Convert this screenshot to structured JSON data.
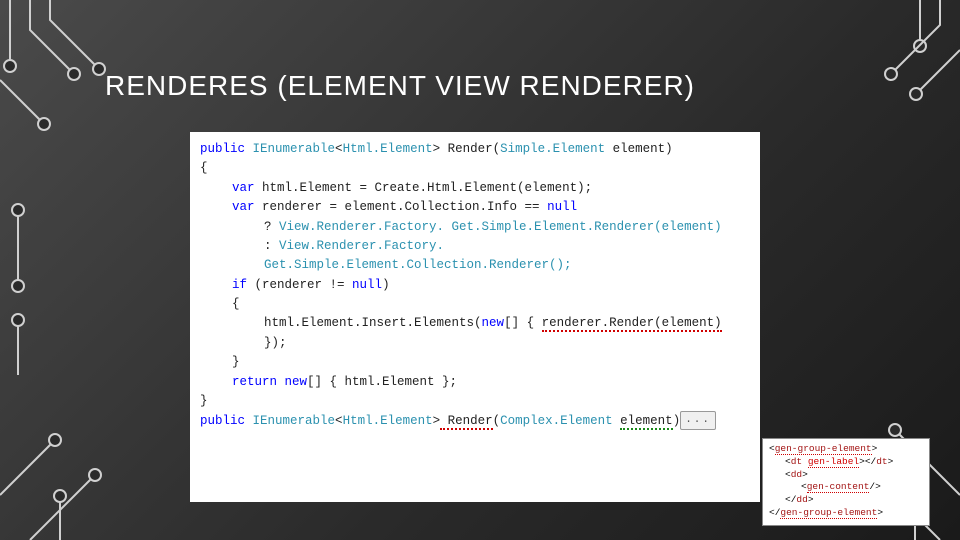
{
  "title": "RENDERES (ELEMENT VIEW RENDERER)",
  "code": {
    "l1_public": "public",
    "l1_ienum": "IEnumerable",
    "l1_lt": "<",
    "l1_htmlel": "Html.Element",
    "l1_gt": ">",
    "l1_render": " Render(",
    "l1_simpleel": "Simple.Element",
    "l1_param": " element)",
    "l2": "{",
    "l3_var": "var",
    "l3_rest": " html.Element = Create.Html.Element(element);",
    "l4": "",
    "l5_var": "var",
    "l5_rest": " renderer = element.Collection.Info == ",
    "l5_null": "null",
    "l6_q": "? ",
    "l6_call": "View.Renderer.Factory. Get.Simple.Element.Renderer(element)",
    "l7_c": ": ",
    "l7_call": "View.Renderer.Factory. Get.Simple.Element.Collection.Renderer();",
    "l8": "",
    "l9_if": "if",
    "l9_rest": " (renderer != ",
    "l9_null": "null",
    "l9_close": ")",
    "l10": "{",
    "l11_pre": "html.Element.Insert.Elements(",
    "l11_new": "new",
    "l11_mid": "[] { ",
    "l11_err": "renderer.Render(element)",
    "l11_post": " });",
    "l12": "}",
    "l13": "",
    "l14_ret": "return",
    "l14_new": " new",
    "l14_rest": "[] { html.Element };",
    "l15": "}",
    "l16": "",
    "l17_public": "public",
    "l17_ienum": "IEnumerable",
    "l17_lt": "<",
    "l17_htmlel": "Html.Element",
    "l17_gt": ">",
    "l17_render": " Render",
    "l17_open": "(",
    "l17_complex": "Complex.Element",
    "l17_sp": " ",
    "l17_param": "element",
    "l17_close": ")",
    "collapse": "..."
  },
  "snippet": {
    "l1_open": "<",
    "l1_tag": "gen-group-element",
    "l1_close": ">",
    "l2_open": "<",
    "l2_dt": "dt",
    "l2_sp": " ",
    "l2_attr": "gen-label",
    "l2_mid": "></",
    "l2_dt2": "dt",
    "l2_close": ">",
    "l3_open": "<",
    "l3_dd": "dd",
    "l3_close": ">",
    "l4_open": "<",
    "l4_tag": "gen-content",
    "l4_close": "/>",
    "l5_open": "</",
    "l5_dd": "dd",
    "l5_close": ">",
    "l6_open": "</",
    "l6_tag": "gen-group-element",
    "l6_close": ">"
  }
}
